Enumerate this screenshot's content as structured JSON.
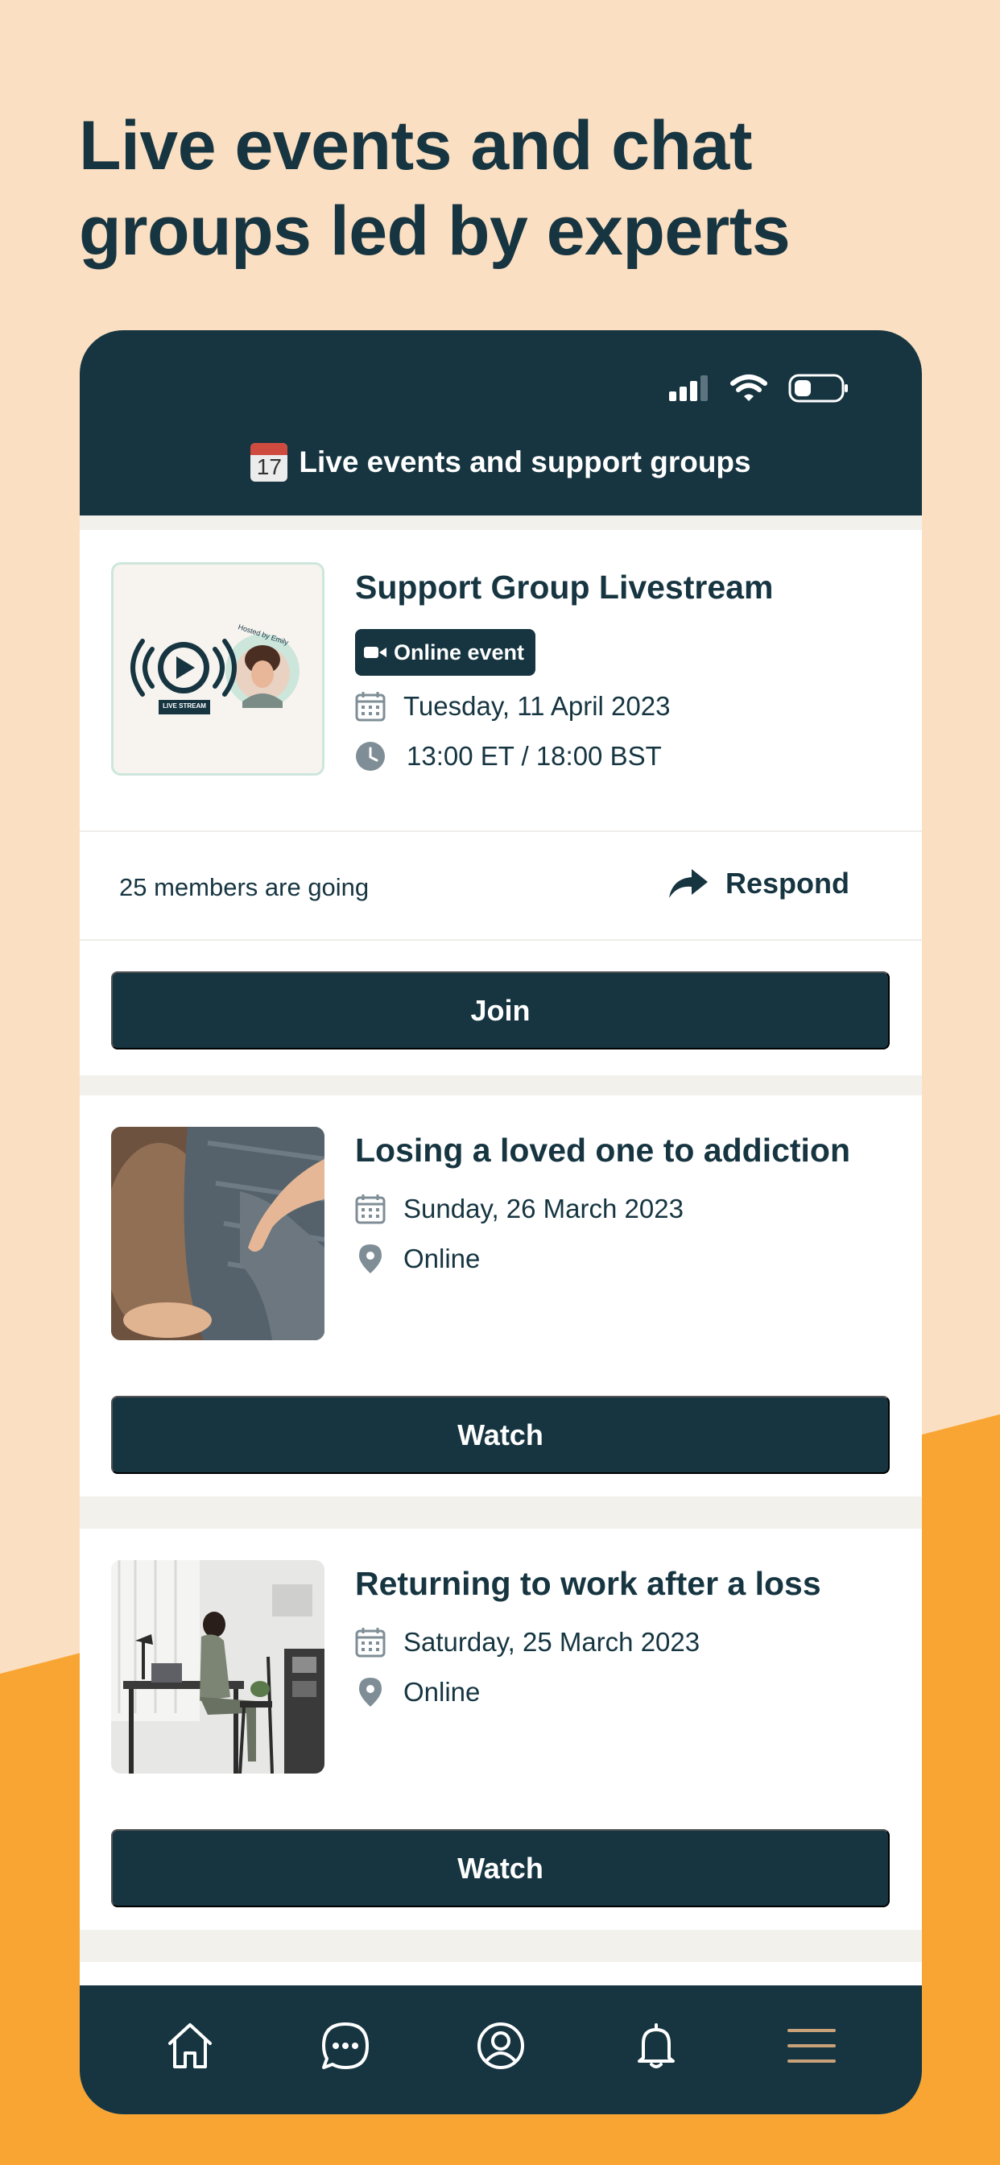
{
  "headline": "Live events and chat groups led by experts",
  "colors": {
    "peach_background": "#FBDFC2",
    "orange_accent": "#F9A533",
    "navy": "#163541",
    "gold_menu": "#C9A27A"
  },
  "screen": {
    "title_emoji_day": "17",
    "title": "Live events and support groups"
  },
  "events": [
    {
      "title": "Support Group Livestream",
      "badge": "Online event",
      "date": "Tuesday, 11 April 2023",
      "time": "13:00 ET / 18:00 BST",
      "thumb_caption": "LIVE STREAM",
      "thumb_host": "Hosted by Emily",
      "attendance": "25 members are going",
      "respond_label": "Respond",
      "button": "Join"
    },
    {
      "title": "Losing a loved one to addiction",
      "date": "Sunday, 26 March 2023",
      "location": "Online",
      "button": "Watch"
    },
    {
      "title": "Returning to work after a loss",
      "date": "Saturday, 25 March 2023",
      "location": "Online",
      "button": "Watch"
    }
  ],
  "tabbar": {
    "icons": [
      "home-icon",
      "chat-bubble-icon",
      "profile-icon",
      "bell-icon",
      "menu-icon"
    ]
  }
}
